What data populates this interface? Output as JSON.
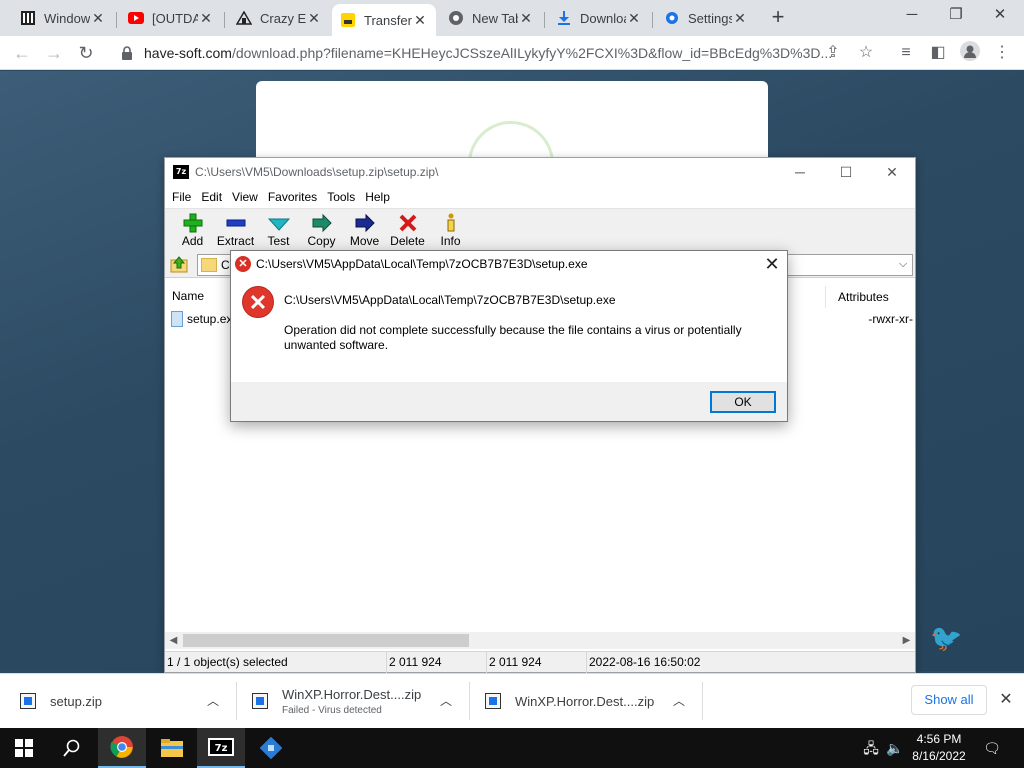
{
  "browser": {
    "tabs": [
      {
        "title": "Windows",
        "icon": "windows-icon"
      },
      {
        "title": "[OUTDATED]",
        "icon": "youtube-icon"
      },
      {
        "title": "Crazy Error",
        "icon": "site-icon"
      },
      {
        "title": "Transfer",
        "icon": "transfer-icon",
        "active": true
      },
      {
        "title": "New Tab",
        "icon": "chrome-icon"
      },
      {
        "title": "Downloads",
        "icon": "download-icon"
      },
      {
        "title": "Settings",
        "icon": "gear-icon"
      }
    ],
    "url_host": "have-soft.com",
    "url_rest": "/download.php?filename=KHEHeycJCSszeAlILykyfyY%2FCXI%3D&flow_id=BBcEdg%3D%3D..."
  },
  "zip": {
    "title": "C:\\Users\\VM5\\Downloads\\setup.zip\\setup.zip\\",
    "menu": [
      "File",
      "Edit",
      "View",
      "Favorites",
      "Tools",
      "Help"
    ],
    "tools": [
      {
        "label": "Add",
        "icon": "plus-icon",
        "color": "#1db11d"
      },
      {
        "label": "Extract",
        "icon": "minus-icon",
        "color": "#1d3fc4"
      },
      {
        "label": "Test",
        "icon": "checkmark-icon",
        "color": "#21b5c4"
      },
      {
        "label": "Copy",
        "icon": "double-arrow-icon",
        "color": "#1f8a6a"
      },
      {
        "label": "Move",
        "icon": "arrow-right-icon",
        "color": "#1a2a90"
      },
      {
        "label": "Delete",
        "icon": "x-icon",
        "color": "#d41a1a"
      },
      {
        "label": "Info",
        "icon": "info-icon",
        "color": "#c99a00"
      }
    ],
    "path": "C:",
    "col_name": "Name",
    "col_attributes": "Attributes",
    "file_name": "setup.exe",
    "file_attr": "-rwxr-xr-",
    "status": [
      "1 / 1 object(s) selected",
      "2 011 924",
      "2 011 924",
      "2022-08-16 16:50:02"
    ]
  },
  "dialog": {
    "title": "C:\\Users\\VM5\\AppData\\Local\\Temp\\7zOCB7B7E3D\\setup.exe",
    "path": "C:\\Users\\VM5\\AppData\\Local\\Temp\\7zOCB7B7E3D\\setup.exe",
    "message": "Operation did not complete successfully because the file contains a virus or potentially unwanted software.",
    "ok": "OK"
  },
  "downloads": {
    "items": [
      {
        "name": "setup.zip",
        "status": ""
      },
      {
        "name": "WinXP.Horror.Dest....zip",
        "status": "Failed - Virus detected"
      },
      {
        "name": "WinXP.Horror.Dest....zip",
        "status": ""
      }
    ],
    "show_all": "Show all"
  },
  "taskbar": {
    "time": "4:56 PM",
    "date": "8/16/2022"
  }
}
